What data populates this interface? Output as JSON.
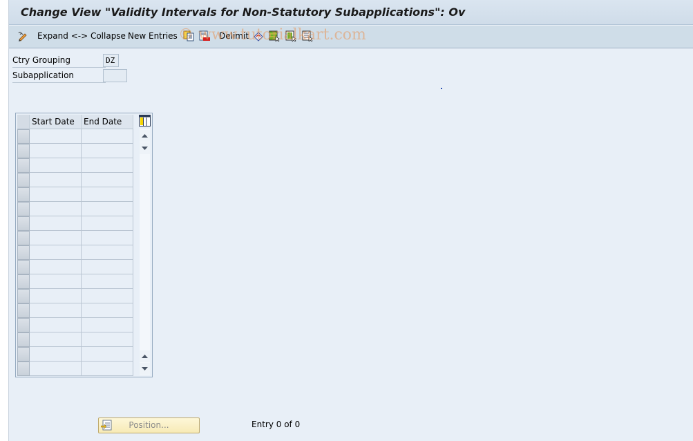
{
  "window": {
    "title": "Change View \"Validity Intervals for Non-Statutory Subapplications\": Ov"
  },
  "toolbar": {
    "items": [
      {
        "icon": "edit-pencil-icon",
        "label": ""
      },
      {
        "label": "Expand <-> Collapse"
      },
      {
        "label": "New Entries"
      },
      {
        "icon": "copy-as-icon"
      },
      {
        "icon": "delete-icon"
      },
      {
        "label": "Delimit"
      },
      {
        "icon": "undo-change-icon"
      },
      {
        "icon": "select-all-icon"
      },
      {
        "icon": "select-block-icon"
      },
      {
        "icon": "deselect-all-icon"
      }
    ],
    "expand_collapse_label": "Expand <-> Collapse",
    "new_entries_label": "New Entries",
    "delimit_label": "Delimit",
    "watermark": "© www.tutorialkart.com"
  },
  "fields": {
    "ctry_grouping": {
      "label": "Ctry Grouping",
      "value": "DZ"
    },
    "subapplication": {
      "label": "Subapplication",
      "value": ""
    }
  },
  "table": {
    "columns": [
      "Start Date",
      "End Date"
    ],
    "rows": [
      [
        "",
        ""
      ],
      [
        "",
        ""
      ],
      [
        "",
        ""
      ],
      [
        "",
        ""
      ],
      [
        "",
        ""
      ],
      [
        "",
        ""
      ],
      [
        "",
        ""
      ],
      [
        "",
        ""
      ],
      [
        "",
        ""
      ],
      [
        "",
        ""
      ],
      [
        "",
        ""
      ],
      [
        "",
        ""
      ],
      [
        "",
        ""
      ],
      [
        "",
        ""
      ],
      [
        "",
        ""
      ],
      [
        "",
        ""
      ],
      [
        "",
        ""
      ]
    ]
  },
  "footer": {
    "position_button_label": "Position...",
    "entry_info": "Entry 0 of 0"
  }
}
